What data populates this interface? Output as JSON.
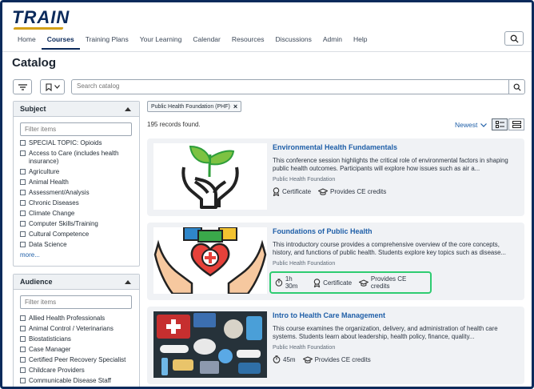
{
  "app": {
    "logo": "TRAIN"
  },
  "nav": [
    {
      "label": "Home",
      "active": false
    },
    {
      "label": "Courses",
      "active": true
    },
    {
      "label": "Training Plans",
      "active": false
    },
    {
      "label": "Your Learning",
      "active": false
    },
    {
      "label": "Calendar",
      "active": false
    },
    {
      "label": "Resources",
      "active": false
    },
    {
      "label": "Discussions",
      "active": false
    },
    {
      "label": "Admin",
      "active": false
    },
    {
      "label": "Help",
      "active": false
    }
  ],
  "page": {
    "title": "Catalog"
  },
  "search": {
    "placeholder": "Search catalog",
    "value": ""
  },
  "filters": {
    "subject": {
      "title": "Subject",
      "filter_placeholder": "Filter items",
      "items": [
        "SPECIAL TOPIC: Opioids",
        "Access to Care (includes health insurance)",
        "Agriculture",
        "Animal Health",
        "Assessment/Analysis",
        "Chronic Diseases",
        "Climate Change",
        "Computer Skills/Training",
        "Cultural Competence",
        "Data Science"
      ],
      "more_label": "more..."
    },
    "audience": {
      "title": "Audience",
      "filter_placeholder": "Filter items",
      "items": [
        "Allied Health Professionals",
        "Animal Control / Veterinarians",
        "Biostatisticians",
        "Case Manager",
        "Certified Peer Recovery Specialist",
        "Childcare Providers",
        "Communicable Disease Staff"
      ]
    }
  },
  "active_filter": {
    "label": "Public Health Foundation (PHF)",
    "remove": "×"
  },
  "results": {
    "count_text": "195 records found.",
    "sort_label": "Newest"
  },
  "courses": [
    {
      "title": "Environmental Health Fundamentals",
      "description": "This conference session highlights the critical role of environmental factors in shaping public health outcomes. Participants will explore how issues such as air a...",
      "provider": "Public Health Foundation",
      "duration": "",
      "certificate": "Certificate",
      "ce": "Provides CE credits"
    },
    {
      "title": "Foundations of Public Health",
      "description": "This introductory course provides a comprehensive overview of the core concepts, history, and functions of public health. Students explore key topics such as disease...",
      "provider": "Public Health Foundation",
      "duration": "1h 30m",
      "certificate": "Certificate",
      "ce": "Provides CE credits"
    },
    {
      "title": "Intro to Health Care Management",
      "description": "This course examines the organization, delivery, and administration of health care systems. Students learn about leadership, health policy, finance, quality...",
      "provider": "Public Health Foundation",
      "duration": "45m",
      "certificate": "",
      "ce": "Provides CE credits"
    }
  ],
  "colors": {
    "brand": "#0b2a5b",
    "accent": "#d4a017",
    "link": "#1f5fa8",
    "highlight": "#2ecc71"
  }
}
